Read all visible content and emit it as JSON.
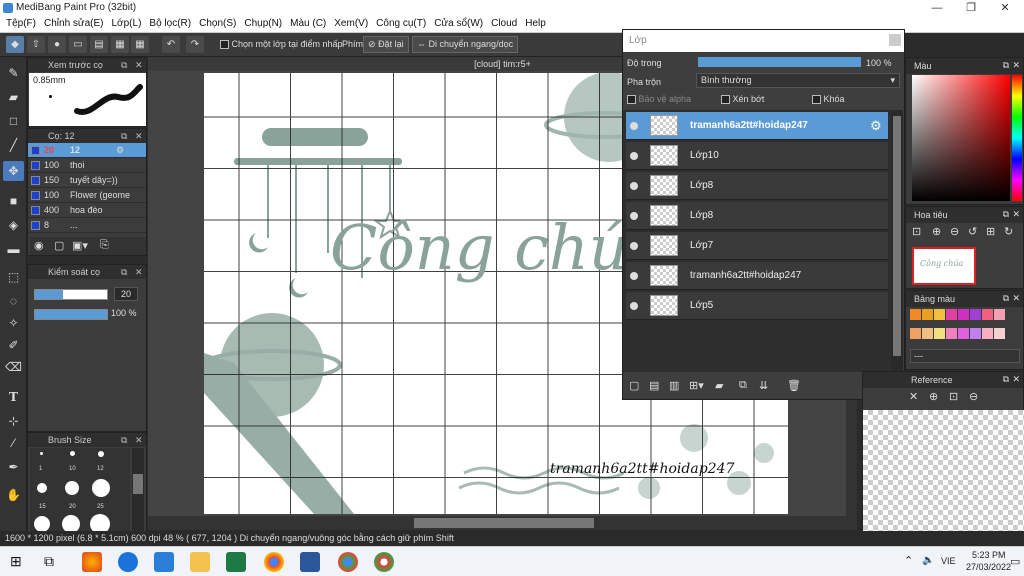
{
  "titlebar": {
    "title": "MediBang Paint Pro (32bit)",
    "min": "—",
    "max": "❐",
    "close": "✕"
  },
  "menu": [
    "Tệp(F)",
    "Chỉnh sửa(E)",
    "Lớp(L)",
    "Bộ lọc(R)",
    "Chọn(S)",
    "Chụp(N)",
    "Màu (C)",
    "Xem(V)",
    "Công cụ(T)",
    "Cửa sổ(W)",
    "Cloud",
    "Help"
  ],
  "toolbar": {
    "select_one_layer": "Chọn một lớp tại điểm nhấp",
    "key_label": "Phím",
    "reset": "Đặt lại",
    "move_hv": "Di chuyển ngang/dọc"
  },
  "brush_preview": {
    "title": "Xem trước cọ",
    "size": "0.85mm"
  },
  "brush_panel": {
    "title": "Cọ: 12",
    "items": [
      {
        "size": "20",
        "name": "12",
        "selected": true
      },
      {
        "size": "100",
        "name": "thoi"
      },
      {
        "size": "150",
        "name": "tuyết dây=))"
      },
      {
        "size": "100",
        "name": "Flower (geome"
      },
      {
        "size": "400",
        "name": "hoa đèo"
      },
      {
        "size": "8",
        "name": "..."
      }
    ]
  },
  "brush_control": {
    "title": "Kiểm soát cọ",
    "size_value": "20",
    "opacity_value": "100 %"
  },
  "brush_size": {
    "title": "Brush Size",
    "labels": [
      "1",
      "10",
      "12",
      "15",
      "20",
      "25"
    ]
  },
  "canvas": {
    "tab": "[cloud] tim:r5+",
    "title_text": "Công chúa",
    "signature": "tramanh6a2tt#hoidap247"
  },
  "layer_panel": {
    "title": "Lớp",
    "opacity_label": "Độ trong",
    "opacity_value": "100 %",
    "blend_label": "Pha trộn",
    "blend_value": "Bình thường",
    "protect_alpha": "Bảo vệ alpha",
    "clipping": "Xén bớt",
    "lock": "Khóa",
    "layers": [
      {
        "name": "tramanh6a2tt#hoidap247",
        "selected": true
      },
      {
        "name": "Lớp10"
      },
      {
        "name": "Lớp8"
      },
      {
        "name": "Lớp8"
      },
      {
        "name": "Lớp7"
      },
      {
        "name": "tramanh6a2tt#hoidap247"
      },
      {
        "name": "Lớp5"
      }
    ]
  },
  "right_panels": {
    "color": "Màu",
    "navigator": "Hoa tiêu",
    "palette": "Bảng màu",
    "palette_field": "---",
    "reference": "Reference"
  },
  "palette_colors": [
    "#f08a24",
    "#e8a020",
    "#f0c040",
    "#e040a0",
    "#d030c0",
    "#a040d0",
    "#f06080",
    "#f0a0b0",
    "#f0a060",
    "#f0c080",
    "#f0e080",
    "#f080c0",
    "#e060e0",
    "#c080f0",
    "#f8b0c0",
    "#f8d0d0"
  ],
  "status": {
    "text": "1600 * 1200 pixel   (6.8 * 5.1cm)   600 dpi   48 %   ( 677, 1204 )   Di chuyển ngang/vuông góc bằng cách giữ phím Shift"
  },
  "taskbar": {
    "lang": "VIE",
    "time": "5:23 PM",
    "date": "27/03/2022"
  },
  "colors": {
    "accent": "#5b9bd5",
    "canvas_sage": "#8aa39a"
  }
}
